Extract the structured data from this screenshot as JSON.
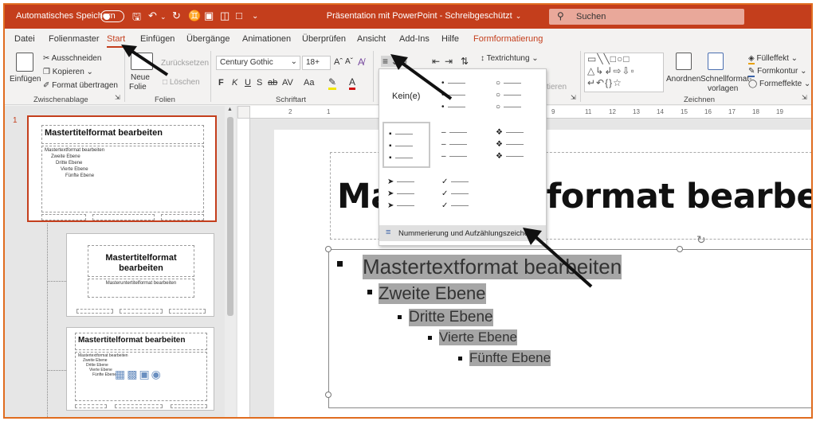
{
  "titlebar": {
    "autosave_label": "Automatisches Speichern",
    "document_title": "Präsentation mit PowerPoint - Schreibgeschützt",
    "search_placeholder": "Suchen"
  },
  "tabs": [
    "Datei",
    "Folienmaster",
    "Start",
    "Einfügen",
    "Übergänge",
    "Animationen",
    "Überprüfen",
    "Ansicht",
    "Add-Ins",
    "Hilfe",
    "Formformatierung"
  ],
  "ribbon": {
    "clipboard": {
      "paste": "Einfügen",
      "cut": "Ausschneiden",
      "copy": "Kopieren",
      "format_painter": "Format übertragen",
      "label": "Zwischenablage"
    },
    "slides": {
      "new_slide_1": "Neue",
      "new_slide_2": "Folie",
      "reset": "Zurücksetzen",
      "delete": "Löschen",
      "label": "Folien"
    },
    "font": {
      "name": "Century Gothic",
      "size": "18+",
      "bold": "F",
      "italic": "K",
      "underline": "U",
      "strike": "S",
      "strike2": "ab",
      "spacing": "AV",
      "case": "Aa",
      "label": "Schriftart"
    },
    "paragraph": {
      "text_direction": "Textrichtung",
      "align_partial": "tieren",
      "label": ""
    },
    "drawing": {
      "arrange": "Anordnen",
      "quickstyles_1": "Schnellformat-",
      "quickstyles_2": "vorlagen",
      "fill": "Fülleffekt",
      "outline": "Formkontur",
      "effects": "Formeffekte",
      "label": "Zeichnen"
    }
  },
  "thumbnails": {
    "slide_number": "1",
    "master_title": "Mastertitelformat bearbeiten",
    "master_body": [
      "Mastertextformat bearbeiten",
      "Zweite Ebene",
      "Dritte Ebene",
      "Vierte Ebene",
      "Fünfte Ebene"
    ],
    "layout2_title_1": "Mastertitelformat",
    "layout2_title_2": "bearbeiten",
    "layout2_sub": "Masteruntertitelformat bearbeiten",
    "layout3_title": "Mastertitelformat bearbeiten"
  },
  "ruler_ticks": [
    "2",
    "1",
    "9",
    "11",
    "12",
    "13",
    "14",
    "15",
    "16",
    "17",
    "18",
    "19"
  ],
  "slide": {
    "title": "Mastertitelformat bearbeiten",
    "levels": [
      "Mastertextformat bearbeiten",
      "Zweite Ebene",
      "Dritte Ebene",
      "Vierte Ebene",
      "Fünfte Ebene"
    ]
  },
  "bullet_dropdown": {
    "none_label": "Kein(e)",
    "footer": "Nummerierung und Aufzählungszeichen..."
  },
  "colors": {
    "accent": "#c43e1c",
    "highlight_text_bg": "#a6a6a6",
    "annotation_frame": "#e06c1f"
  }
}
